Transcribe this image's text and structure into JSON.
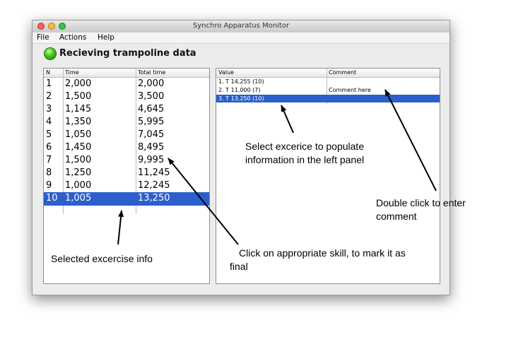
{
  "window": {
    "title": "Synchro Apparatus Monitor",
    "traffic_lights": [
      {
        "name": "close",
        "color": "#ff5f57"
      },
      {
        "name": "minimize",
        "color": "#febc2e"
      },
      {
        "name": "zoom",
        "color": "#28c840"
      }
    ]
  },
  "menu": [
    "File",
    "Actions",
    "Help"
  ],
  "status": {
    "text": "Recieving trampoline data",
    "color": "#47c219"
  },
  "left_table": {
    "headers": [
      "N",
      "Time",
      "Total time"
    ],
    "rows": [
      [
        "1",
        "2,000",
        "2,000"
      ],
      [
        "2",
        "1,500",
        "3,500"
      ],
      [
        "3",
        "1,145",
        "4,645"
      ],
      [
        "4",
        "1,350",
        "5,995"
      ],
      [
        "5",
        "1,050",
        "7,045"
      ],
      [
        "6",
        "1,450",
        "8,495"
      ],
      [
        "7",
        "1,500",
        "9,995"
      ],
      [
        "8",
        "1,250",
        "11,245"
      ],
      [
        "9",
        "1,000",
        "12,245"
      ],
      [
        "10",
        "1,005",
        "13,250"
      ]
    ],
    "selected_index": 9
  },
  "right_table": {
    "headers": [
      "Value",
      "Comment"
    ],
    "rows": [
      [
        "1. T 14,255 (10)",
        ""
      ],
      [
        "2. T 11,000 (7)",
        "Comment here"
      ],
      [
        "3. T 13,250 (10)",
        ""
      ]
    ],
    "selected_index": 2
  },
  "annotations": {
    "select_exercise": "Select excerice to populate information in the left panel",
    "double_click": "Double click to enter comment",
    "selected_info": "Selected excercise info",
    "click_skill": "Click on appropriate skill, to mark it as final"
  },
  "colors": {
    "selection": "#2a5fcc"
  }
}
